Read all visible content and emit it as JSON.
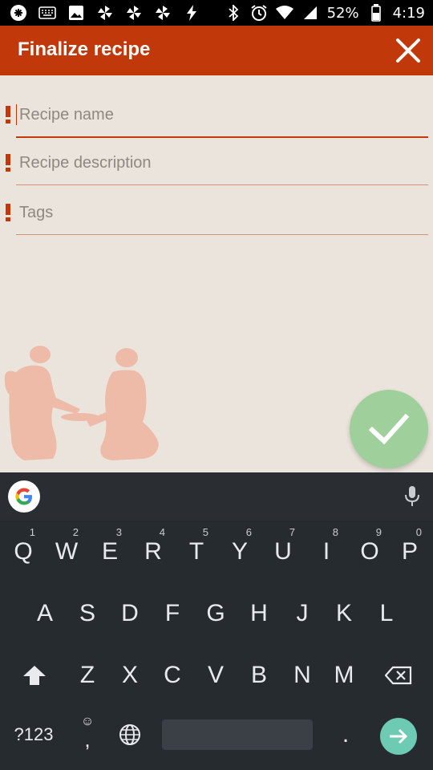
{
  "status_bar": {
    "battery": "52%",
    "time": "4:19"
  },
  "app_bar": {
    "title": "Finalize recipe",
    "color": "#c1390b"
  },
  "form": {
    "fields": [
      {
        "placeholder": "Recipe name",
        "required": true
      },
      {
        "placeholder": "Recipe description",
        "required": true
      },
      {
        "placeholder": "Tags",
        "required": true
      }
    ]
  },
  "keyboard": {
    "row1": [
      "Q",
      "W",
      "E",
      "R",
      "T",
      "Y",
      "U",
      "I",
      "O",
      "P"
    ],
    "row1_hints": [
      "1",
      "2",
      "3",
      "4",
      "5",
      "6",
      "7",
      "8",
      "9",
      "0"
    ],
    "row2": [
      "A",
      "S",
      "D",
      "F",
      "G",
      "H",
      "J",
      "K",
      "L"
    ],
    "row3": [
      "Z",
      "X",
      "C",
      "V",
      "B",
      "N",
      "M"
    ],
    "symbols_key": "?123",
    "period_key": ".",
    "comma_key": ","
  }
}
